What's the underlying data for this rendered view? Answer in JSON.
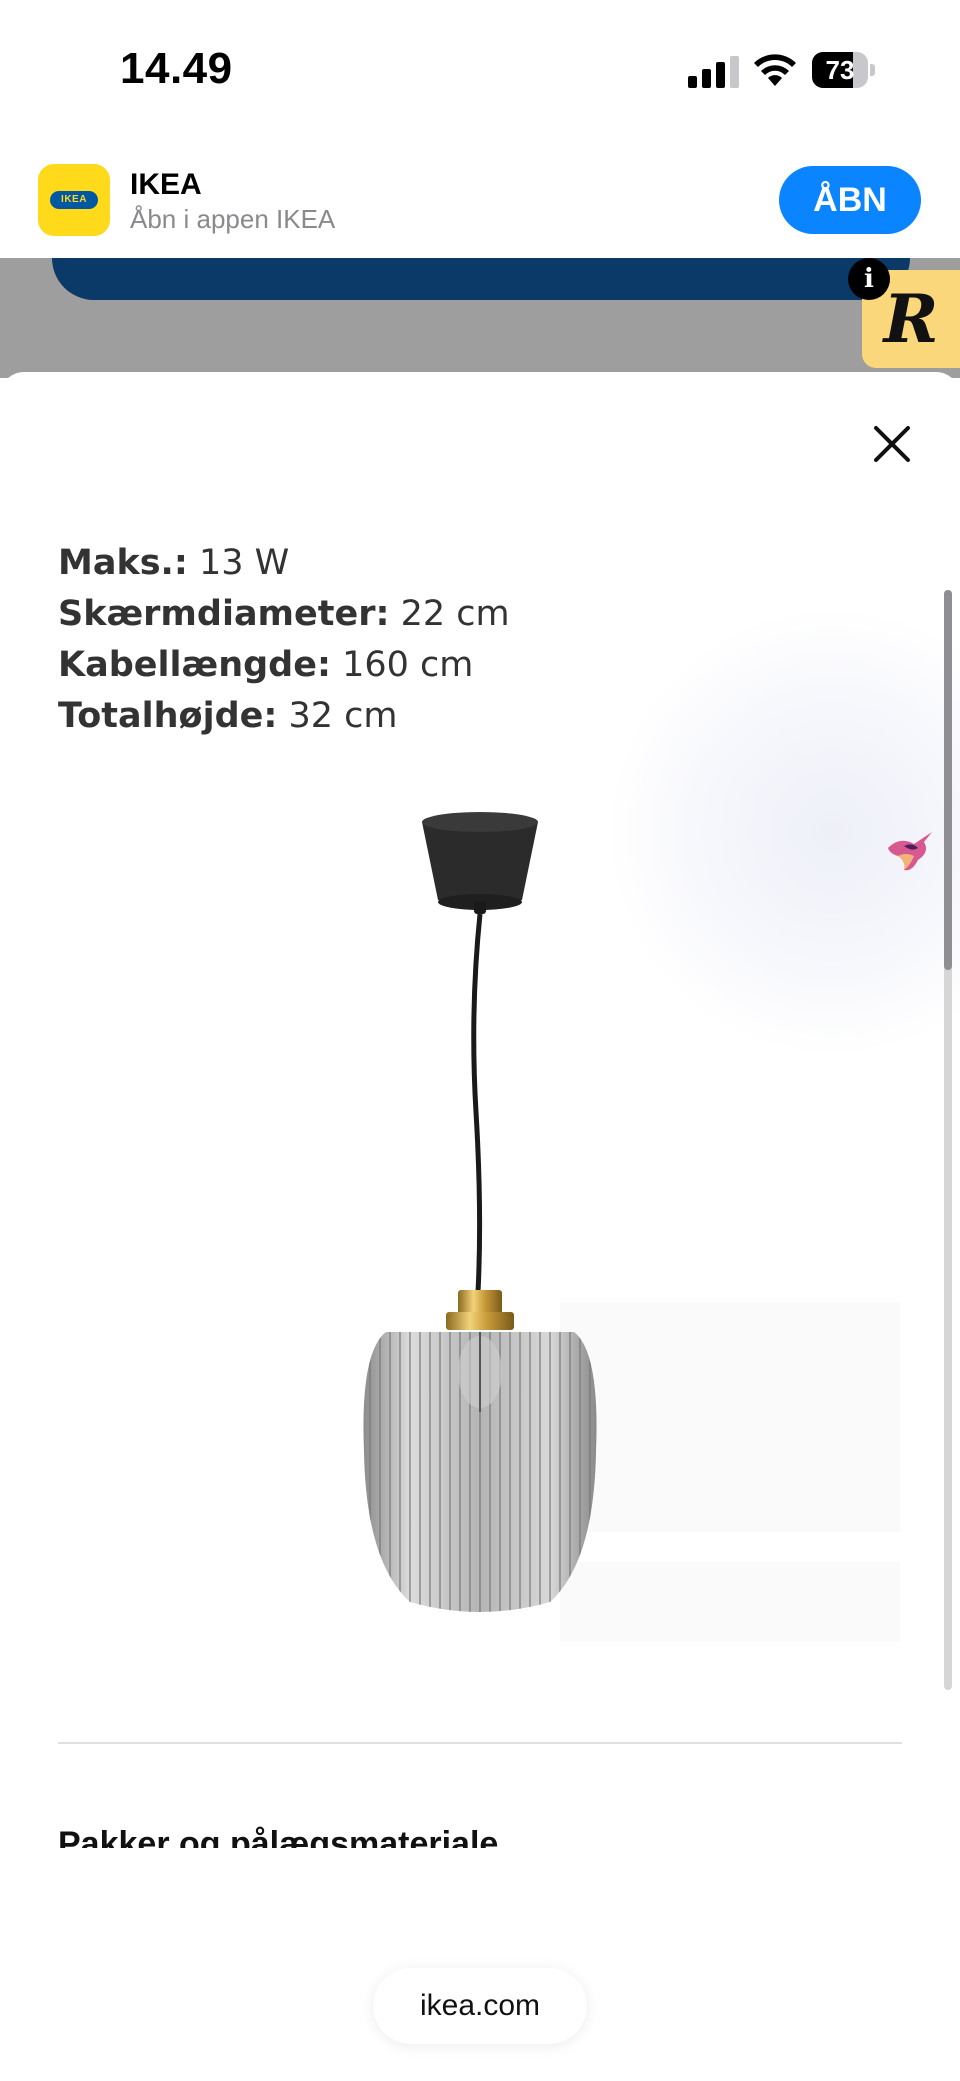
{
  "status_bar": {
    "time": "14.49",
    "battery": "73",
    "battery_level": 0.73
  },
  "app_banner": {
    "icon_text": "IKEA",
    "title": "IKEA",
    "subtitle": "Åbn i appen IKEA",
    "open_label": "ÅBN",
    "accent_color": "#0a84ff",
    "brand_yellow": "#ffda1a",
    "brand_blue": "#0058a3"
  },
  "extension_badge": {
    "letter": "R",
    "info": "i"
  },
  "sheet": {
    "specs": [
      {
        "label": "Maks.:",
        "value": " 13 W"
      },
      {
        "label": "Skærmdiameter:",
        "value": " 22 cm"
      },
      {
        "label": "Kabellængde:",
        "value": " 160 cm"
      },
      {
        "label": "Totalhøjde:",
        "value": " 32 cm"
      }
    ],
    "next_heading": "Pakker og pålægsmateriale"
  },
  "url_bar": {
    "domain": "ikea.com"
  }
}
